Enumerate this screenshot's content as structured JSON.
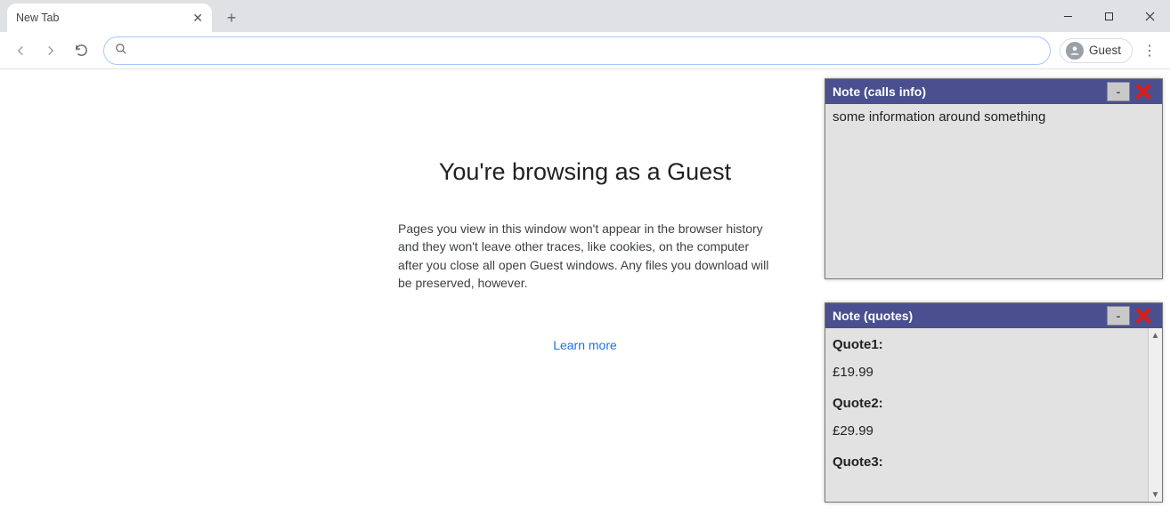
{
  "titlebar": {
    "tab_title": "New Tab"
  },
  "toolbar": {
    "profile_label": "Guest",
    "omnibox_value": ""
  },
  "guest": {
    "heading": "You're browsing as a Guest",
    "body": "Pages you view in this window won't appear in the browser history and they won't leave other traces, like cookies, on the computer after you close all open Guest windows. Any files you download will be preserved, however.",
    "learn_more": "Learn more"
  },
  "notes": {
    "calls": {
      "title": "Note (calls info)",
      "body": "some information around something"
    },
    "quotes": {
      "title": "Note (quotes)",
      "items": [
        {
          "label": "Quote1:",
          "value": "£19.99"
        },
        {
          "label": "Quote2:",
          "value": "£29.99"
        },
        {
          "label": "Quote3:",
          "value": ""
        }
      ]
    }
  }
}
